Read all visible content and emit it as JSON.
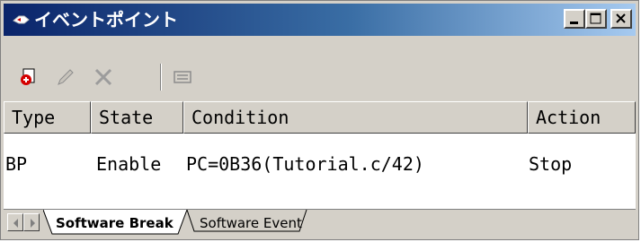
{
  "window": {
    "title": "イベントポイント",
    "title_icon": "eventpoint-icon",
    "titlebar_colors": [
      "#0a246a",
      "#a6caf0"
    ]
  },
  "caption_buttons": {
    "minimize": "minimize-icon",
    "maximize": "maximize-icon",
    "close": "close-icon"
  },
  "toolbar": {
    "buttons": [
      {
        "icon": "add-breakpoint-icon",
        "enabled": true
      },
      {
        "icon": "edit-pencil-icon",
        "enabled": false
      },
      {
        "icon": "delete-x-icon",
        "enabled": false
      },
      {
        "icon": "properties-icon",
        "enabled": false
      }
    ]
  },
  "table": {
    "columns": [
      "Type",
      "State",
      "Condition",
      "Action"
    ],
    "rows": [
      {
        "type": "BP",
        "state": "Enable",
        "condition": "PC=0B36(Tutorial.c/42)",
        "action": "Stop"
      }
    ]
  },
  "tabs": {
    "items": [
      {
        "label": "Software Break",
        "active": true
      },
      {
        "label": "Software Event",
        "active": false
      }
    ],
    "scroll_left": "scroll-left-icon",
    "scroll_right": "scroll-right-icon"
  }
}
